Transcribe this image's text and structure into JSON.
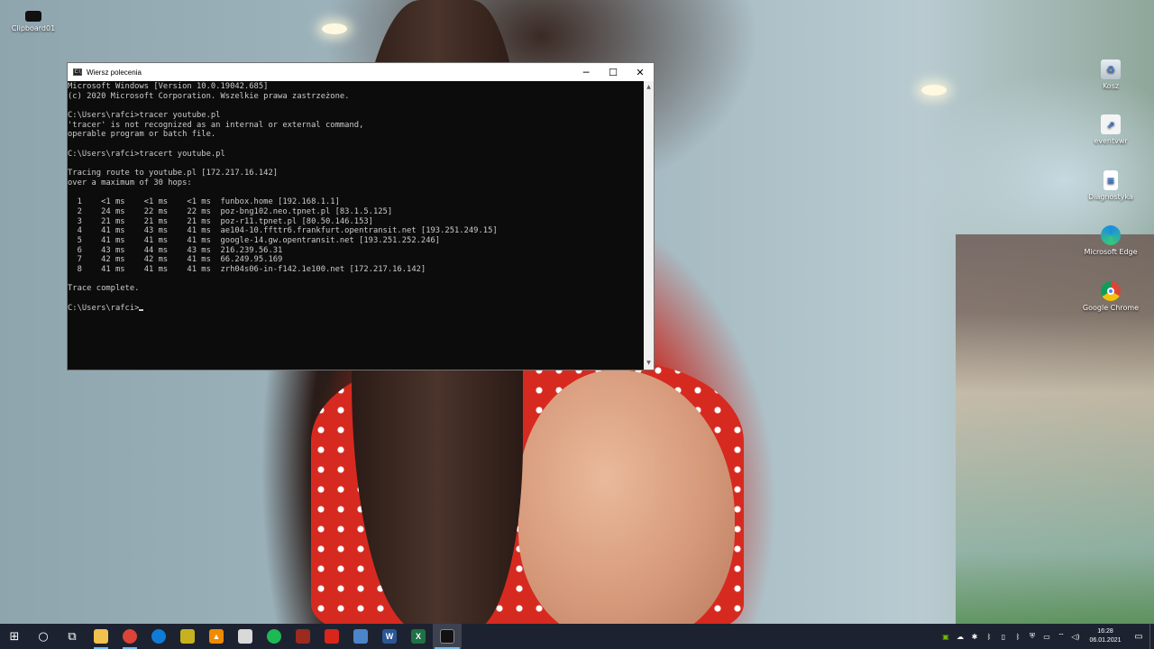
{
  "desktop": {
    "icons_left": [
      {
        "label": "Clipboard01",
        "icon": "image-file-icon"
      }
    ],
    "icons_right": [
      {
        "label": "Kosz",
        "icon": "recycle-bin-icon"
      },
      {
        "label": "eventvwr",
        "icon": "shortcut-icon"
      },
      {
        "label": "Diagnostyka",
        "icon": "document-icon"
      },
      {
        "label": "Microsoft Edge",
        "icon": "edge-icon"
      },
      {
        "label": "Google Chrome",
        "icon": "chrome-icon"
      }
    ]
  },
  "window": {
    "title": "Wiersz polecenia",
    "icon": "cmd-icon",
    "buttons": {
      "minimize": "─",
      "maximize": "☐",
      "close": "✕"
    },
    "console_lines": [
      "Microsoft Windows [Version 10.0.19042.685]",
      "(c) 2020 Microsoft Corporation. Wszelkie prawa zastrzeżone.",
      "",
      "C:\\Users\\rafci>tracer youtube.pl",
      "'tracer' is not recognized as an internal or external command,",
      "operable program or batch file.",
      "",
      "C:\\Users\\rafci>tracert youtube.pl",
      "",
      "Tracing route to youtube.pl [172.217.16.142]",
      "over a maximum of 30 hops:",
      "",
      "  1    <1 ms    <1 ms    <1 ms  funbox.home [192.168.1.1]",
      "  2    24 ms    22 ms    22 ms  poz-bng102.neo.tpnet.pl [83.1.5.125]",
      "  3    21 ms    21 ms    21 ms  poz-r11.tpnet.pl [80.50.146.153]",
      "  4    41 ms    43 ms    41 ms  ae104-10.ffttr6.frankfurt.opentransit.net [193.251.249.15]",
      "  5    41 ms    41 ms    41 ms  google-14.gw.opentransit.net [193.251.252.246]",
      "  6    43 ms    44 ms    43 ms  216.239.56.31",
      "  7    42 ms    42 ms    41 ms  66.249.95.169",
      "  8    41 ms    41 ms    41 ms  zrh04s06-in-f142.1e100.net [172.217.16.142]",
      "",
      "Trace complete.",
      ""
    ],
    "prompt": "C:\\Users\\rafci>"
  },
  "taskbar": {
    "items": [
      {
        "name": "start-button",
        "icon": "windows-icon",
        "glyph": "⊞"
      },
      {
        "name": "search-button",
        "icon": "search-circle-icon",
        "glyph": "○"
      },
      {
        "name": "task-view-button",
        "icon": "task-view-icon",
        "glyph": "⧉"
      },
      {
        "name": "explorer-button",
        "icon": "folder-icon",
        "glyph": "",
        "color": "#f2c14e"
      },
      {
        "name": "chrome-button",
        "icon": "chrome-icon",
        "glyph": "",
        "color": "#db4437"
      },
      {
        "name": "edge-button",
        "icon": "edge-icon",
        "glyph": "",
        "color": "#0f7bd8"
      },
      {
        "name": "app-button-1",
        "icon": "yellow-app-icon",
        "glyph": "",
        "color": "#c6b21e"
      },
      {
        "name": "vlc-button",
        "icon": "vlc-icon",
        "glyph": "▲",
        "color": "#f08a00"
      },
      {
        "name": "app-button-2",
        "icon": "shield-app-icon",
        "glyph": "",
        "color": "#d9d9d9"
      },
      {
        "name": "spotify-button",
        "icon": "spotify-icon",
        "glyph": "",
        "color": "#1db954"
      },
      {
        "name": "app-button-3",
        "icon": "red-app-icon",
        "glyph": "",
        "color": "#9b2a1f"
      },
      {
        "name": "acrobat-button",
        "icon": "acrobat-icon",
        "glyph": "",
        "color": "#d8261c"
      },
      {
        "name": "app-button-4",
        "icon": "network-app-icon",
        "glyph": "",
        "color": "#4c84c9"
      },
      {
        "name": "word-button",
        "icon": "word-icon",
        "glyph": "W",
        "color": "#2b5797"
      },
      {
        "name": "excel-button",
        "icon": "excel-icon",
        "glyph": "X",
        "color": "#1e7145"
      },
      {
        "name": "cmd-button",
        "icon": "cmd-icon",
        "glyph": "",
        "color": "#111111"
      }
    ],
    "tray_icons": [
      "nvidia-icon",
      "onedrive-icon",
      "network-tray-icon",
      "bluetooth-tray-icon",
      "usb-icon",
      "bluetooth-icon",
      "security-icon",
      "display-icon",
      "wifi-icon",
      "volume-icon"
    ],
    "clock": {
      "time": "16:28",
      "date": "06.01.2021"
    },
    "notification_icon": "notification-icon"
  }
}
